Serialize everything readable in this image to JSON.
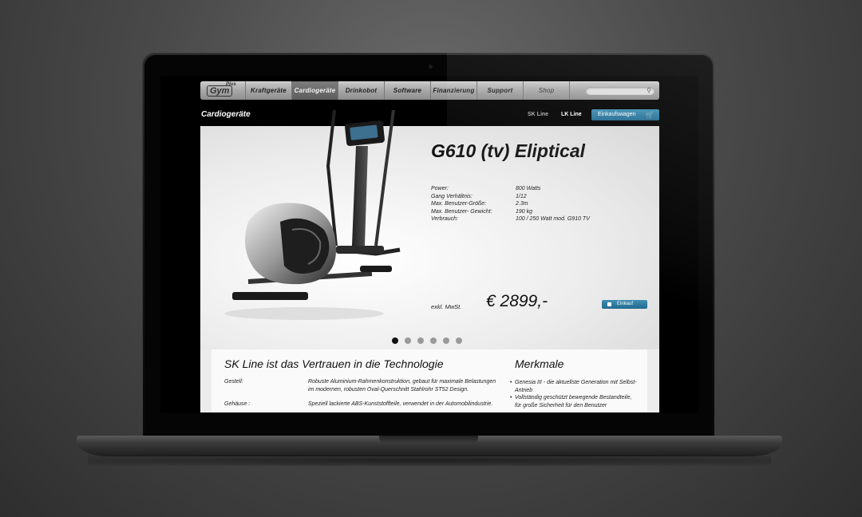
{
  "nav": {
    "logo": "Gym",
    "logo_sup": "Plus",
    "items": [
      {
        "label": "Kraftgeräte"
      },
      {
        "label": "Cardiogeräte"
      },
      {
        "label": "Drinkobot"
      },
      {
        "label": "Software"
      },
      {
        "label": "Finanzierung"
      },
      {
        "label": "Support"
      },
      {
        "label": "Shop"
      }
    ],
    "active": "Cardiogeräte",
    "search_placeholder": ""
  },
  "page": {
    "heading": "Cardiogeräte",
    "line_links": [
      "SK Line",
      "LK Line"
    ],
    "cart_label": "Einkaufswagen"
  },
  "product": {
    "title": "G610 (tv) Eliptical",
    "specs": [
      {
        "label": "Power:",
        "value": "800 Watts"
      },
      {
        "label": "Gang Verhältnis:",
        "value": "1/12"
      },
      {
        "label": "Max. Benutzer-Größe:",
        "value": "2.3m"
      },
      {
        "label": "Max. Benutzer- Gewicht:",
        "value": "190 kg"
      },
      {
        "label": "Verbrauch:",
        "value": "100 / 250 Watt mod. G910 TV"
      }
    ],
    "tax_note": "exkl. MwSt.",
    "price": "€ 2899,-",
    "buy_label": "Einkauf",
    "carousel_count": 6,
    "carousel_active": 1
  },
  "details": {
    "heading": "SK Line ist das Vertrauen in die Technologie",
    "rows": [
      {
        "label": "Gestell:",
        "text": "Robuste Aluminium-Rahmenkonstruktion, gebaut für maximale Belastungen im modernen, robusten Oval-Querschnitt Stahlrohr ST52 Design."
      },
      {
        "label": "Gehäuse :",
        "text": "Speziell lackierte ABS-Kunststoffteile, verwendet in der Automobilindustrie."
      }
    ],
    "features_heading": "Merkmale",
    "features": [
      "Genesia III - die aktuellste Generation mit Selbst-Antrieb",
      "Vollständig geschützt bewegende Bestandteile, für große Sicherheit für den Benutzer"
    ]
  },
  "colors": {
    "accent": "#2f7fa6",
    "nav_active": "#666666"
  }
}
